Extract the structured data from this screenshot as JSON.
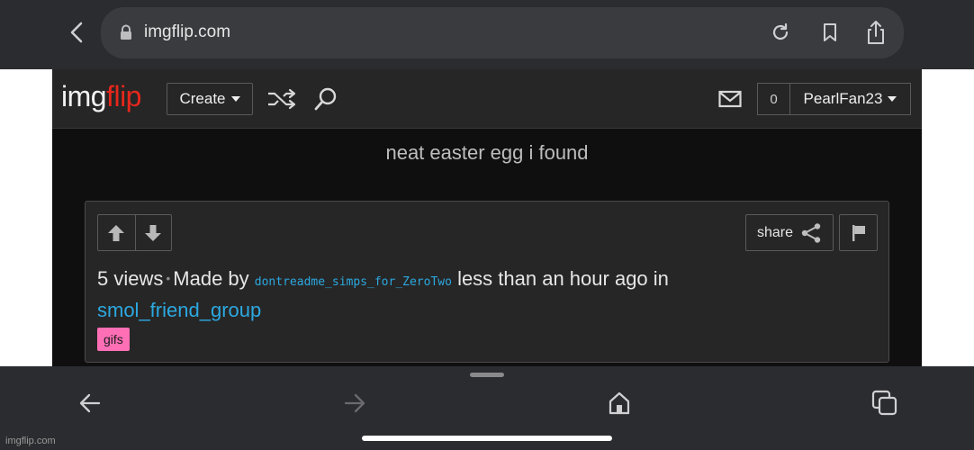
{
  "browser": {
    "url": "imgflip.com",
    "icons": [
      "chevron-left-icon",
      "lock-icon",
      "reload-icon",
      "bookmark-icon",
      "share-icon"
    ]
  },
  "site": {
    "logo_img": "img",
    "logo_flip": "flip",
    "create_label": "Create",
    "notification_count": "0",
    "username": "PearlFan23",
    "colors": {
      "logo_accent": "#e5271c",
      "link": "#2ca8e0",
      "tag_bg": "#ff6fb6"
    }
  },
  "post": {
    "title": "neat easter egg i found",
    "share_label": "share",
    "views": "5 views",
    "separator": "•",
    "made_by": "Made by",
    "author": "dontreadme_simps_for_ZeroTwo",
    "time_text": "less than an hour ago in",
    "stream": "smol_friend_group",
    "tag": "gifs"
  },
  "bottom_toolbar": {
    "icons": [
      "back-arrow-icon",
      "forward-arrow-icon",
      "home-icon",
      "tabs-icon"
    ]
  },
  "watermark": "imgflip.com"
}
